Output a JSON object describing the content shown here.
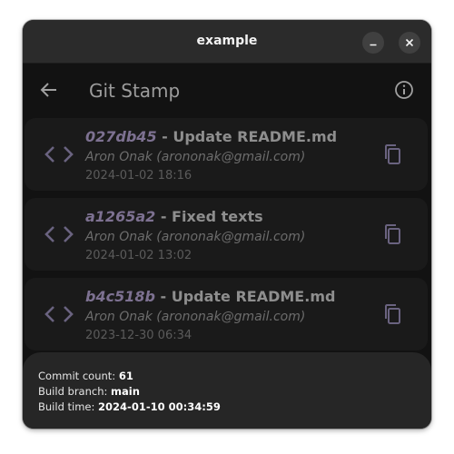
{
  "window": {
    "title": "example",
    "minimize_icon": "minimize-icon",
    "close_icon": "close-icon"
  },
  "appbar": {
    "title": "Git Stamp",
    "back_icon": "arrow-left-icon",
    "info_icon": "info-icon"
  },
  "commits": [
    {
      "hash": "027db45",
      "separator": " - ",
      "message": "Update README.md",
      "author": "Aron Onak (arononak@gmail.com)",
      "date": "2024-01-02 18:16"
    },
    {
      "hash": "a1265a2",
      "separator": " - ",
      "message": "Fixed texts",
      "author": "Aron Onak (arononak@gmail.com)",
      "date": "2024-01-02 13:02"
    },
    {
      "hash": "b4c518b",
      "separator": " - ",
      "message": "Update README.md",
      "author": "Aron Onak (arononak@gmail.com)",
      "date": "2023-12-30 06:34"
    }
  ],
  "build_info": {
    "commit_count_label": "Commit count: ",
    "commit_count": "61",
    "branch_label": "Build branch: ",
    "branch": "main",
    "time_label": "Build time: ",
    "time": "2024-01-10 00:34:59"
  },
  "colors": {
    "background": "#121212",
    "card": "#1a1a1a",
    "hash": "#7d7191",
    "icon": "#6a6380",
    "sheet": "#262626"
  }
}
